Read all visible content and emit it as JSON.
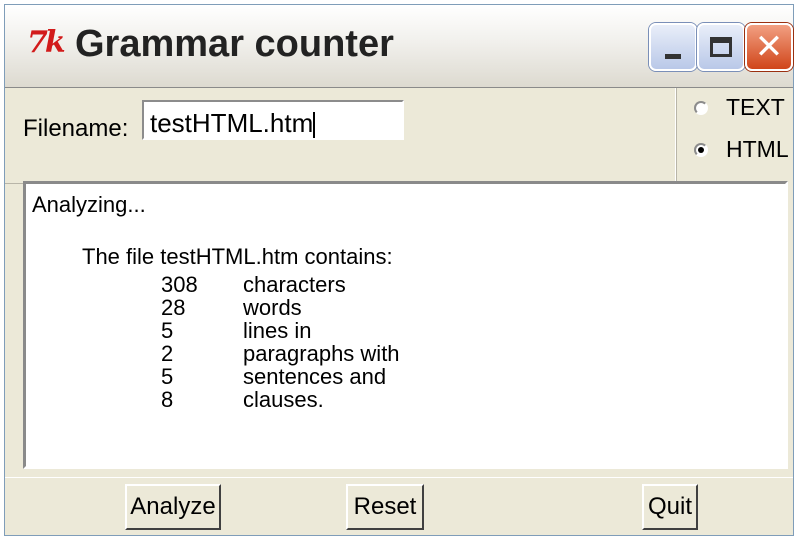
{
  "window": {
    "title": "Grammar counter",
    "logo_text": "7k",
    "controls": [
      "minimize",
      "maximize",
      "close"
    ]
  },
  "filename": {
    "label": "Filename:",
    "value": "testHTML.htm"
  },
  "mode": {
    "options": [
      {
        "label": "TEXT",
        "selected": false
      },
      {
        "label": "HTML",
        "selected": true
      }
    ]
  },
  "output": {
    "status": "Analyzing...",
    "summary": "The file testHTML.htm contains:",
    "stats": [
      {
        "count": "308",
        "label": "characters"
      },
      {
        "count": "28",
        "label": "words"
      },
      {
        "count": "5",
        "label": "lines in"
      },
      {
        "count": "2",
        "label": "paragraphs with"
      },
      {
        "count": "5",
        "label": "sentences and"
      },
      {
        "count": "8",
        "label": "clauses."
      }
    ]
  },
  "buttons": {
    "analyze": "Analyze",
    "reset": "Reset",
    "quit": "Quit"
  }
}
